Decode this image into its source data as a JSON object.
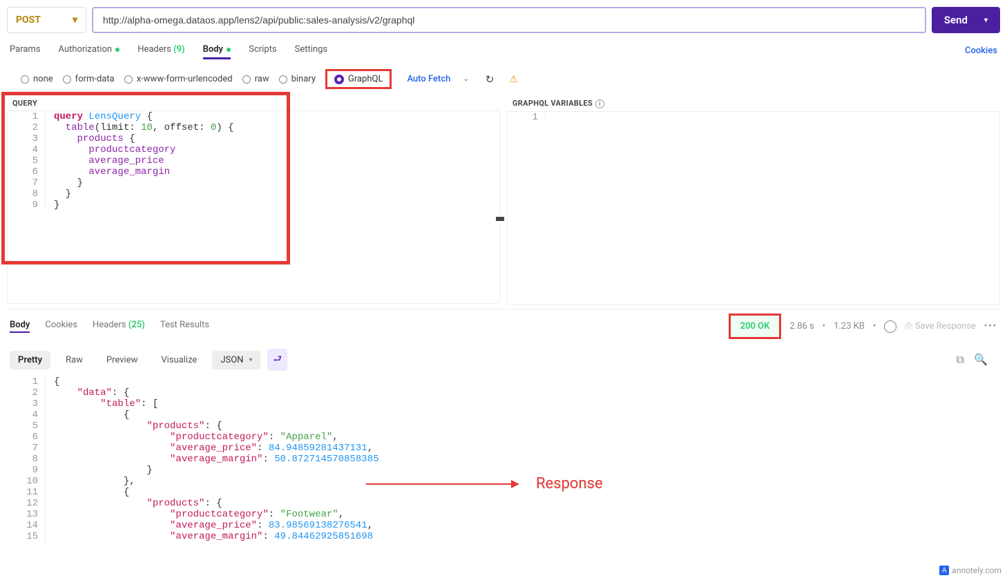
{
  "request": {
    "method": "POST",
    "url": "http://alpha-omega.dataos.app/lens2/api/public:sales-analysis/v2/graphql",
    "send_label": "Send"
  },
  "tabs": {
    "params": "Params",
    "authorization": "Authorization",
    "headers": "Headers",
    "headers_count": "(9)",
    "body": "Body",
    "scripts": "Scripts",
    "settings": "Settings",
    "cookies": "Cookies"
  },
  "body_types": {
    "none": "none",
    "form_data": "form-data",
    "urlencoded": "x-www-form-urlencoded",
    "raw": "raw",
    "binary": "binary",
    "graphql": "GraphQL",
    "auto_fetch": "Auto Fetch"
  },
  "query": {
    "header": "QUERY",
    "lines": [
      {
        "n": "1",
        "t": "query",
        "c": "kw",
        "a": " ",
        "n2": "LensQuery",
        "c2": "fn",
        "tail": " {"
      },
      {
        "n": "2",
        "t": "  table",
        "c": "fld",
        "tail": "(limit: ",
        "num1": "10",
        "mid": ", offset: ",
        "num2": "0",
        "end": ") {"
      },
      {
        "n": "3",
        "t": "    products",
        "c": "fld",
        "tail": " {"
      },
      {
        "n": "4",
        "t": "      productcategory",
        "c": "fld"
      },
      {
        "n": "5",
        "t": "      average_price",
        "c": "fld"
      },
      {
        "n": "6",
        "t": "      average_margin",
        "c": "fld"
      },
      {
        "n": "7",
        "t": "    }"
      },
      {
        "n": "8",
        "t": "  }"
      },
      {
        "n": "9",
        "t": "}"
      }
    ]
  },
  "variables": {
    "header": "GRAPHQL VARIABLES",
    "line1_num": "1"
  },
  "response_tabs": {
    "body": "Body",
    "cookies": "Cookies",
    "headers": "Headers",
    "headers_count": "(25)",
    "test_results": "Test Results"
  },
  "response_meta": {
    "status": "200 OK",
    "time": "2.86 s",
    "size": "1.23 KB",
    "save": "Save Response"
  },
  "view": {
    "pretty": "Pretty",
    "raw": "Raw",
    "preview": "Preview",
    "visualize": "Visualize",
    "json": "JSON"
  },
  "response_body": [
    {
      "n": "1",
      "t": "{"
    },
    {
      "n": "2",
      "k": "    \"data\"",
      "t": ": {"
    },
    {
      "n": "3",
      "k": "        \"table\"",
      "t": ": ["
    },
    {
      "n": "4",
      "t": "            {"
    },
    {
      "n": "5",
      "k": "                \"products\"",
      "t": ": {"
    },
    {
      "n": "6",
      "k": "                    \"productcategory\"",
      "t": ": ",
      "s": "\"Apparel\"",
      "e": ","
    },
    {
      "n": "7",
      "k": "                    \"average_price\"",
      "t": ": ",
      "v": "84.94859281437131",
      "e": ","
    },
    {
      "n": "8",
      "k": "                    \"average_margin\"",
      "t": ": ",
      "v": "50.872714570858385"
    },
    {
      "n": "9",
      "t": "                }"
    },
    {
      "n": "10",
      "t": "            },"
    },
    {
      "n": "11",
      "t": "            {"
    },
    {
      "n": "12",
      "k": "                \"products\"",
      "t": ": {"
    },
    {
      "n": "13",
      "k": "                    \"productcategory\"",
      "t": ": ",
      "s": "\"Footwear\"",
      "e": ","
    },
    {
      "n": "14",
      "k": "                    \"average_price\"",
      "t": ": ",
      "v": "83.98569138276541",
      "e": ","
    },
    {
      "n": "15",
      "k": "                    \"average_margin\"",
      "t": ": ",
      "v": "49.84462925851698"
    }
  ],
  "annotation": {
    "label": "Response"
  },
  "watermark": {
    "text": "annotely.com"
  }
}
